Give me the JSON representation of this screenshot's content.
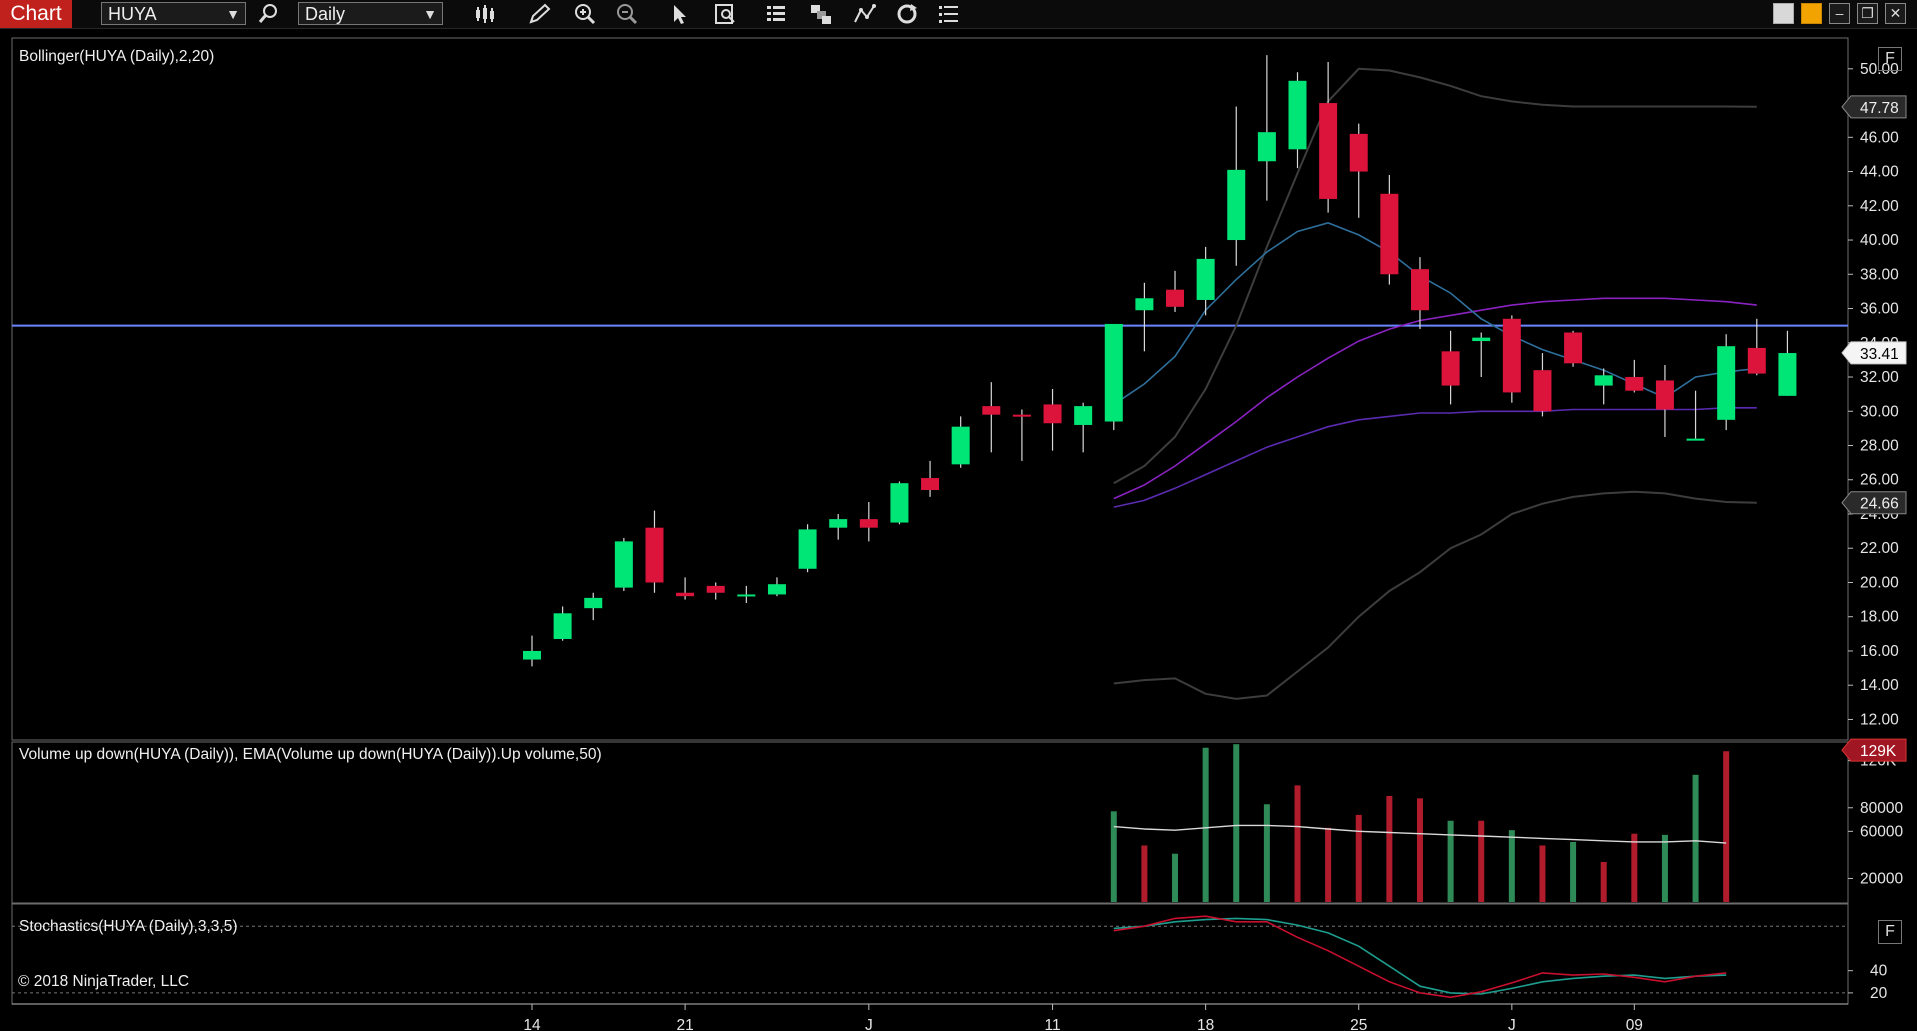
{
  "toolbar": {
    "tab_label": "Chart",
    "instrument": "HUYA",
    "interval": "Daily",
    "icons": [
      "bar-type-icon",
      "draw-pencil-icon",
      "zoom-in-icon",
      "zoom-out-icon",
      "pointer-icon",
      "data-box-icon",
      "properties-icon",
      "templates-icon",
      "strategies-icon",
      "reload-icon",
      "menu-list-icon"
    ]
  },
  "colors": {
    "up": "#00e676",
    "down": "#dc143c",
    "hline": "#6b86ff",
    "panel_border": "#6d6d6d"
  },
  "panels": {
    "price_title": "Bollinger(HUYA (Daily),2,20)",
    "volume_title": "Volume up down(HUYA (Daily)), EMA(Volume up down(HUYA (Daily)).Up volume,50)",
    "stoch_title": "Stochastics(HUYA (Daily),3,3,5)",
    "f_label": "F"
  },
  "watermark": "© 2018 NinjaTrader, LLC",
  "chart_data": {
    "type": "candlestick",
    "price_axis": {
      "ylim": [
        10.8,
        51.8
      ],
      "ticks": [
        "50.00",
        "48.00",
        "46.00",
        "44.00",
        "42.00",
        "40.00",
        "38.00",
        "36.00",
        "34.00",
        "32.00",
        "30.00",
        "28.00",
        "26.00",
        "24.00",
        "22.00",
        "20.00",
        "18.00",
        "16.00",
        "14.00",
        "12.00"
      ],
      "badges": [
        {
          "label": "47.78",
          "value": 47.78,
          "style": "grey"
        },
        {
          "label": "33.41",
          "value": 33.41,
          "style": "white"
        },
        {
          "label": "24.66",
          "value": 24.66,
          "style": "grey"
        }
      ],
      "horizontal_line": 35.0
    },
    "x_axis": {
      "labels": [
        {
          "text": "14",
          "index": 0
        },
        {
          "text": "21",
          "index": 5
        },
        {
          "text": "J",
          "index": 11
        },
        {
          "text": "11",
          "index": 17
        },
        {
          "text": "18",
          "index": 22
        },
        {
          "text": "25",
          "index": 27
        },
        {
          "text": "J",
          "index": 32
        },
        {
          "text": "09",
          "index": 36
        }
      ]
    },
    "candles": [
      {
        "o": 15.5,
        "h": 16.9,
        "l": 15.1,
        "c": 16.0
      },
      {
        "o": 16.7,
        "h": 18.6,
        "l": 16.6,
        "c": 18.2
      },
      {
        "o": 18.5,
        "h": 19.4,
        "l": 17.8,
        "c": 19.1
      },
      {
        "o": 19.7,
        "h": 22.6,
        "l": 19.5,
        "c": 22.4
      },
      {
        "o": 23.2,
        "h": 24.2,
        "l": 19.4,
        "c": 20.0
      },
      {
        "o": 19.4,
        "h": 20.3,
        "l": 19.0,
        "c": 19.2
      },
      {
        "o": 19.8,
        "h": 20.0,
        "l": 19.0,
        "c": 19.4
      },
      {
        "o": 19.3,
        "h": 19.8,
        "l": 18.8,
        "c": 19.3
      },
      {
        "o": 19.3,
        "h": 20.3,
        "l": 19.2,
        "c": 19.9
      },
      {
        "o": 20.8,
        "h": 23.4,
        "l": 20.6,
        "c": 23.1
      },
      {
        "o": 23.2,
        "h": 24.0,
        "l": 22.5,
        "c": 23.7
      },
      {
        "o": 23.7,
        "h": 24.7,
        "l": 22.4,
        "c": 23.2
      },
      {
        "o": 23.5,
        "h": 25.9,
        "l": 23.4,
        "c": 25.8
      },
      {
        "o": 26.1,
        "h": 27.1,
        "l": 25.0,
        "c": 25.4
      },
      {
        "o": 26.9,
        "h": 29.7,
        "l": 26.7,
        "c": 29.1
      },
      {
        "o": 30.3,
        "h": 31.7,
        "l": 27.6,
        "c": 29.8
      },
      {
        "o": 29.8,
        "h": 30.1,
        "l": 27.1,
        "c": 29.7
      },
      {
        "o": 30.4,
        "h": 31.3,
        "l": 27.7,
        "c": 29.3
      },
      {
        "o": 29.2,
        "h": 30.5,
        "l": 27.6,
        "c": 30.3
      },
      {
        "o": 29.4,
        "h": 35.0,
        "l": 28.9,
        "c": 35.1
      },
      {
        "o": 35.9,
        "h": 37.5,
        "l": 33.5,
        "c": 36.6
      },
      {
        "o": 37.1,
        "h": 38.2,
        "l": 35.8,
        "c": 36.1
      },
      {
        "o": 36.5,
        "h": 39.6,
        "l": 35.6,
        "c": 38.9
      },
      {
        "o": 40.0,
        "h": 47.8,
        "l": 38.5,
        "c": 44.1
      },
      {
        "o": 44.6,
        "h": 50.8,
        "l": 42.3,
        "c": 46.3
      },
      {
        "o": 45.3,
        "h": 49.8,
        "l": 44.2,
        "c": 49.3
      },
      {
        "o": 48.0,
        "h": 50.4,
        "l": 41.6,
        "c": 42.4
      },
      {
        "o": 46.2,
        "h": 46.8,
        "l": 41.3,
        "c": 44.0
      },
      {
        "o": 42.7,
        "h": 43.8,
        "l": 37.4,
        "c": 38.0
      },
      {
        "o": 38.3,
        "h": 39.0,
        "l": 34.8,
        "c": 35.9
      },
      {
        "o": 33.5,
        "h": 34.7,
        "l": 30.4,
        "c": 31.5
      },
      {
        "o": 34.1,
        "h": 34.6,
        "l": 32.0,
        "c": 34.3
      },
      {
        "o": 35.4,
        "h": 35.6,
        "l": 30.5,
        "c": 31.1
      },
      {
        "o": 32.4,
        "h": 33.4,
        "l": 29.7,
        "c": 30.0
      },
      {
        "o": 34.6,
        "h": 34.7,
        "l": 32.6,
        "c": 32.8
      },
      {
        "o": 31.5,
        "h": 32.5,
        "l": 30.4,
        "c": 32.1
      },
      {
        "o": 32.0,
        "h": 33.0,
        "l": 31.1,
        "c": 31.2
      },
      {
        "o": 31.8,
        "h": 32.7,
        "l": 28.5,
        "c": 30.1
      },
      {
        "o": 28.4,
        "h": 31.2,
        "l": 28.4,
        "c": 28.4
      },
      {
        "o": 29.5,
        "h": 34.5,
        "l": 28.9,
        "c": 33.8
      },
      {
        "o": 33.7,
        "h": 35.4,
        "l": 32.1,
        "c": 32.2
      },
      {
        "o": 30.9,
        "h": 34.7,
        "l": 30.9,
        "c": 33.4
      }
    ],
    "bollinger": {
      "upper": [
        {
          "i": 19,
          "v": 25.8
        },
        {
          "i": 20,
          "v": 26.8
        },
        {
          "i": 21,
          "v": 28.5
        },
        {
          "i": 22,
          "v": 31.3
        },
        {
          "i": 23,
          "v": 35.0
        },
        {
          "i": 24,
          "v": 39.6
        },
        {
          "i": 25,
          "v": 43.9
        },
        {
          "i": 26,
          "v": 48.1
        },
        {
          "i": 27,
          "v": 50.0
        },
        {
          "i": 28,
          "v": 49.9
        },
        {
          "i": 29,
          "v": 49.5
        },
        {
          "i": 30,
          "v": 49.0
        },
        {
          "i": 31,
          "v": 48.4
        },
        {
          "i": 32,
          "v": 48.1
        },
        {
          "i": 33,
          "v": 47.9
        },
        {
          "i": 34,
          "v": 47.8
        },
        {
          "i": 35,
          "v": 47.8
        },
        {
          "i": 36,
          "v": 47.8
        },
        {
          "i": 37,
          "v": 47.8
        },
        {
          "i": 38,
          "v": 47.8
        },
        {
          "i": 39,
          "v": 47.8
        },
        {
          "i": 40,
          "v": 47.78
        }
      ],
      "middle": [
        {
          "i": 19,
          "v": 30.4
        },
        {
          "i": 20,
          "v": 31.6
        },
        {
          "i": 21,
          "v": 33.2
        },
        {
          "i": 22,
          "v": 35.9
        },
        {
          "i": 23,
          "v": 37.7
        },
        {
          "i": 24,
          "v": 39.3
        },
        {
          "i": 25,
          "v": 40.5
        },
        {
          "i": 26,
          "v": 41.0
        },
        {
          "i": 27,
          "v": 40.3
        },
        {
          "i": 28,
          "v": 39.3
        },
        {
          "i": 29,
          "v": 37.9
        },
        {
          "i": 30,
          "v": 36.9
        },
        {
          "i": 31,
          "v": 35.4
        },
        {
          "i": 32,
          "v": 34.4
        },
        {
          "i": 33,
          "v": 33.6
        },
        {
          "i": 34,
          "v": 33.0
        },
        {
          "i": 35,
          "v": 32.4
        },
        {
          "i": 36,
          "v": 31.6
        },
        {
          "i": 37,
          "v": 30.8
        },
        {
          "i": 38,
          "v": 32.0
        },
        {
          "i": 39,
          "v": 32.3
        },
        {
          "i": 40,
          "v": 32.5
        }
      ],
      "lower": [
        {
          "i": 19,
          "v": 14.1
        },
        {
          "i": 20,
          "v": 14.3
        },
        {
          "i": 21,
          "v": 14.4
        },
        {
          "i": 22,
          "v": 13.5
        },
        {
          "i": 23,
          "v": 13.2
        },
        {
          "i": 24,
          "v": 13.4
        },
        {
          "i": 25,
          "v": 14.8
        },
        {
          "i": 26,
          "v": 16.2
        },
        {
          "i": 27,
          "v": 18.0
        },
        {
          "i": 28,
          "v": 19.5
        },
        {
          "i": 29,
          "v": 20.6
        },
        {
          "i": 30,
          "v": 22.0
        },
        {
          "i": 31,
          "v": 22.8
        },
        {
          "i": 32,
          "v": 24.0
        },
        {
          "i": 33,
          "v": 24.6
        },
        {
          "i": 34,
          "v": 25.0
        },
        {
          "i": 35,
          "v": 25.2
        },
        {
          "i": 36,
          "v": 25.3
        },
        {
          "i": 37,
          "v": 25.2
        },
        {
          "i": 38,
          "v": 24.9
        },
        {
          "i": 39,
          "v": 24.7
        },
        {
          "i": 40,
          "v": 24.66
        }
      ],
      "band_upper_purple": [
        {
          "i": 19,
          "v": 24.9
        },
        {
          "i": 20,
          "v": 25.7
        },
        {
          "i": 21,
          "v": 26.8
        },
        {
          "i": 22,
          "v": 28.1
        },
        {
          "i": 23,
          "v": 29.4
        },
        {
          "i": 24,
          "v": 30.8
        },
        {
          "i": 25,
          "v": 32.0
        },
        {
          "i": 26,
          "v": 33.1
        },
        {
          "i": 27,
          "v": 34.1
        },
        {
          "i": 28,
          "v": 34.8
        },
        {
          "i": 29,
          "v": 35.3
        },
        {
          "i": 30,
          "v": 35.6
        },
        {
          "i": 31,
          "v": 35.9
        },
        {
          "i": 32,
          "v": 36.2
        },
        {
          "i": 33,
          "v": 36.4
        },
        {
          "i": 34,
          "v": 36.5
        },
        {
          "i": 35,
          "v": 36.6
        },
        {
          "i": 36,
          "v": 36.6
        },
        {
          "i": 37,
          "v": 36.6
        },
        {
          "i": 38,
          "v": 36.5
        },
        {
          "i": 39,
          "v": 36.4
        },
        {
          "i": 40,
          "v": 36.2
        }
      ],
      "band_lower_purple": [
        {
          "i": 19,
          "v": 24.4
        },
        {
          "i": 20,
          "v": 24.8
        },
        {
          "i": 21,
          "v": 25.5
        },
        {
          "i": 22,
          "v": 26.3
        },
        {
          "i": 23,
          "v": 27.1
        },
        {
          "i": 24,
          "v": 27.9
        },
        {
          "i": 25,
          "v": 28.5
        },
        {
          "i": 26,
          "v": 29.1
        },
        {
          "i": 27,
          "v": 29.5
        },
        {
          "i": 28,
          "v": 29.7
        },
        {
          "i": 29,
          "v": 29.9
        },
        {
          "i": 30,
          "v": 29.9
        },
        {
          "i": 31,
          "v": 30.0
        },
        {
          "i": 32,
          "v": 30.0
        },
        {
          "i": 33,
          "v": 30.0
        },
        {
          "i": 34,
          "v": 30.1
        },
        {
          "i": 35,
          "v": 30.1
        },
        {
          "i": 36,
          "v": 30.1
        },
        {
          "i": 37,
          "v": 30.1
        },
        {
          "i": 38,
          "v": 30.1
        },
        {
          "i": 39,
          "v": 30.2
        },
        {
          "i": 40,
          "v": 30.2
        }
      ]
    },
    "volume_axis": {
      "ylim": [
        0,
        135000
      ],
      "ticks": [
        {
          "label": "120K",
          "value": 120000
        },
        {
          "label": "80000",
          "value": 80000
        },
        {
          "label": "60000",
          "value": 60000
        },
        {
          "label": "20000",
          "value": 20000
        }
      ],
      "badge": {
        "label": "129K",
        "value": 129000
      }
    },
    "volume": [
      {
        "i": 19,
        "v": 77000,
        "up": true
      },
      {
        "i": 20,
        "v": 48000,
        "up": false
      },
      {
        "i": 21,
        "v": 41000,
        "up": true
      },
      {
        "i": 22,
        "v": 131000,
        "up": true
      },
      {
        "i": 23,
        "v": 134000,
        "up": true
      },
      {
        "i": 24,
        "v": 83000,
        "up": true
      },
      {
        "i": 25,
        "v": 99000,
        "up": false
      },
      {
        "i": 26,
        "v": 63000,
        "up": false
      },
      {
        "i": 27,
        "v": 74000,
        "up": false
      },
      {
        "i": 28,
        "v": 90000,
        "up": false
      },
      {
        "i": 29,
        "v": 88000,
        "up": false
      },
      {
        "i": 30,
        "v": 69000,
        "up": true
      },
      {
        "i": 31,
        "v": 69000,
        "up": false
      },
      {
        "i": 32,
        "v": 61000,
        "up": true
      },
      {
        "i": 33,
        "v": 48000,
        "up": false
      },
      {
        "i": 34,
        "v": 51000,
        "up": true
      },
      {
        "i": 35,
        "v": 34000,
        "up": false
      },
      {
        "i": 36,
        "v": 58000,
        "up": false
      },
      {
        "i": 37,
        "v": 57000,
        "up": true
      },
      {
        "i": 38,
        "v": 108000,
        "up": true
      },
      {
        "i": 39,
        "v": 128000,
        "up": false
      }
    ],
    "volume_ema": [
      {
        "i": 19,
        "v": 64000
      },
      {
        "i": 20,
        "v": 62000
      },
      {
        "i": 21,
        "v": 61000
      },
      {
        "i": 22,
        "v": 63000
      },
      {
        "i": 23,
        "v": 65000
      },
      {
        "i": 24,
        "v": 65000
      },
      {
        "i": 25,
        "v": 64000
      },
      {
        "i": 26,
        "v": 62000
      },
      {
        "i": 27,
        "v": 60000
      },
      {
        "i": 28,
        "v": 59000
      },
      {
        "i": 29,
        "v": 58000
      },
      {
        "i": 30,
        "v": 57000
      },
      {
        "i": 31,
        "v": 56000
      },
      {
        "i": 32,
        "v": 55000
      },
      {
        "i": 33,
        "v": 54000
      },
      {
        "i": 34,
        "v": 53000
      },
      {
        "i": 35,
        "v": 52000
      },
      {
        "i": 36,
        "v": 51000
      },
      {
        "i": 37,
        "v": 51000
      },
      {
        "i": 38,
        "v": 52000
      },
      {
        "i": 39,
        "v": 50000
      }
    ],
    "stoch_axis": {
      "ylim": [
        10,
        100
      ],
      "ticks": [
        {
          "label": "40",
          "value": 40
        },
        {
          "label": "20",
          "value": 20
        }
      ],
      "levels": [
        20,
        80
      ]
    },
    "stochastics": {
      "d": [
        {
          "i": 19,
          "v": 78
        },
        {
          "i": 20,
          "v": 80
        },
        {
          "i": 21,
          "v": 84
        },
        {
          "i": 22,
          "v": 86
        },
        {
          "i": 23,
          "v": 87
        },
        {
          "i": 24,
          "v": 86
        },
        {
          "i": 25,
          "v": 81
        },
        {
          "i": 26,
          "v": 74
        },
        {
          "i": 27,
          "v": 62
        },
        {
          "i": 28,
          "v": 44
        },
        {
          "i": 29,
          "v": 26
        },
        {
          "i": 30,
          "v": 20
        },
        {
          "i": 31,
          "v": 19
        },
        {
          "i": 32,
          "v": 24
        },
        {
          "i": 33,
          "v": 30
        },
        {
          "i": 34,
          "v": 33
        },
        {
          "i": 35,
          "v": 35
        },
        {
          "i": 36,
          "v": 36
        },
        {
          "i": 37,
          "v": 33
        },
        {
          "i": 38,
          "v": 35
        },
        {
          "i": 39,
          "v": 36
        }
      ],
      "k": [
        {
          "i": 19,
          "v": 76
        },
        {
          "i": 20,
          "v": 80
        },
        {
          "i": 21,
          "v": 87
        },
        {
          "i": 22,
          "v": 89
        },
        {
          "i": 23,
          "v": 84
        },
        {
          "i": 24,
          "v": 84
        },
        {
          "i": 25,
          "v": 70
        },
        {
          "i": 26,
          "v": 58
        },
        {
          "i": 27,
          "v": 44
        },
        {
          "i": 28,
          "v": 30
        },
        {
          "i": 29,
          "v": 20
        },
        {
          "i": 30,
          "v": 16
        },
        {
          "i": 31,
          "v": 21
        },
        {
          "i": 32,
          "v": 29
        },
        {
          "i": 33,
          "v": 38
        },
        {
          "i": 34,
          "v": 36
        },
        {
          "i": 35,
          "v": 37
        },
        {
          "i": 36,
          "v": 34
        },
        {
          "i": 37,
          "v": 30
        },
        {
          "i": 38,
          "v": 35
        },
        {
          "i": 39,
          "v": 38
        }
      ]
    }
  }
}
